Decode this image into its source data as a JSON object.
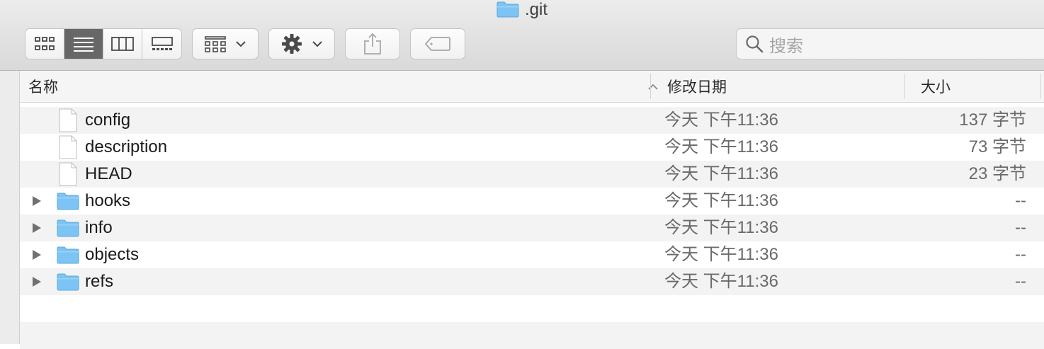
{
  "window": {
    "title": ".git"
  },
  "search": {
    "placeholder": "搜索"
  },
  "columns": {
    "name": "名称",
    "modified": "修改日期",
    "size": "大小"
  },
  "icons": [
    "folder-icon",
    "icon-view-icon",
    "list-view-icon",
    "column-view-icon",
    "gallery-view-icon",
    "group-by-icon",
    "chevron-down-icon",
    "gear-icon",
    "share-icon",
    "tag-icon",
    "search-icon",
    "file-icon",
    "disclosure-triangle-icon",
    "sort-ascending-icon"
  ],
  "colors": {
    "active_segment": "#676767",
    "folder_blue": "#7cc4f4"
  },
  "files": [
    {
      "name": "config",
      "kind": "file",
      "modified": "今天 下午11:36",
      "size": "137 字节"
    },
    {
      "name": "description",
      "kind": "file",
      "modified": "今天 下午11:36",
      "size": "73 字节"
    },
    {
      "name": "HEAD",
      "kind": "file",
      "modified": "今天 下午11:36",
      "size": "23 字节"
    },
    {
      "name": "hooks",
      "kind": "folder",
      "modified": "今天 下午11:36",
      "size": "--"
    },
    {
      "name": "info",
      "kind": "folder",
      "modified": "今天 下午11:36",
      "size": "--"
    },
    {
      "name": "objects",
      "kind": "folder",
      "modified": "今天 下午11:36",
      "size": "--"
    },
    {
      "name": "refs",
      "kind": "folder",
      "modified": "今天 下午11:36",
      "size": "--"
    }
  ]
}
